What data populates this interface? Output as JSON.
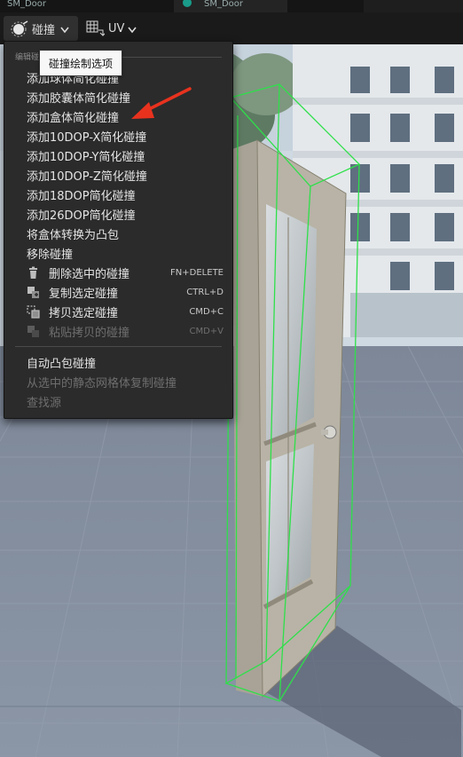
{
  "tabs": [
    "SM_Door",
    "SM_Door"
  ],
  "toolbar": {
    "collision_label": "碰撞",
    "uv_label": "UV",
    "collision_icon": "collision-sphere-icon",
    "uv_icon": "uv-grid-icon"
  },
  "tooltip": "碰撞绘制选项",
  "menu": {
    "section_header": "编辑碰撞",
    "items": [
      {
        "label": "添加球体简化碰撞",
        "shortcut": "",
        "icon": "",
        "disabled": false
      },
      {
        "label": "添加胶囊体简化碰撞",
        "shortcut": "",
        "icon": "",
        "disabled": false
      },
      {
        "label": "添加盒体简化碰撞",
        "shortcut": "",
        "icon": "",
        "disabled": false
      },
      {
        "label": "添加10DOP-X简化碰撞",
        "shortcut": "",
        "icon": "",
        "disabled": false
      },
      {
        "label": "添加10DOP-Y简化碰撞",
        "shortcut": "",
        "icon": "",
        "disabled": false
      },
      {
        "label": "添加10DOP-Z简化碰撞",
        "shortcut": "",
        "icon": "",
        "disabled": false
      },
      {
        "label": "添加18DOP简化碰撞",
        "shortcut": "",
        "icon": "",
        "disabled": false
      },
      {
        "label": "添加26DOP简化碰撞",
        "shortcut": "",
        "icon": "",
        "disabled": false
      },
      {
        "label": "将盒体转换为凸包",
        "shortcut": "",
        "icon": "",
        "disabled": false
      },
      {
        "label": "移除碰撞",
        "shortcut": "",
        "icon": "",
        "disabled": false
      },
      {
        "label": "删除选中的碰撞",
        "shortcut": "FN+DELETE",
        "icon": "trash-icon",
        "disabled": false
      },
      {
        "label": "复制选定碰撞",
        "shortcut": "CTRL+D",
        "icon": "duplicate-icon",
        "disabled": false
      },
      {
        "label": "拷贝选定碰撞",
        "shortcut": "CMD+C",
        "icon": "copy-icon",
        "disabled": false
      },
      {
        "label": "粘贴拷贝的碰撞",
        "shortcut": "CMD+V",
        "icon": "paste-icon",
        "disabled": true
      }
    ],
    "items2": [
      {
        "label": "自动凸包碰撞",
        "disabled": false
      },
      {
        "label": "从选中的静态网格体复制碰撞",
        "disabled": true
      },
      {
        "label": "查找源",
        "disabled": true
      }
    ]
  },
  "colors": {
    "accent_arrow": "#e8321e",
    "collision_wire": "#2ee04a",
    "menu_bg": "#2b2b2b"
  }
}
